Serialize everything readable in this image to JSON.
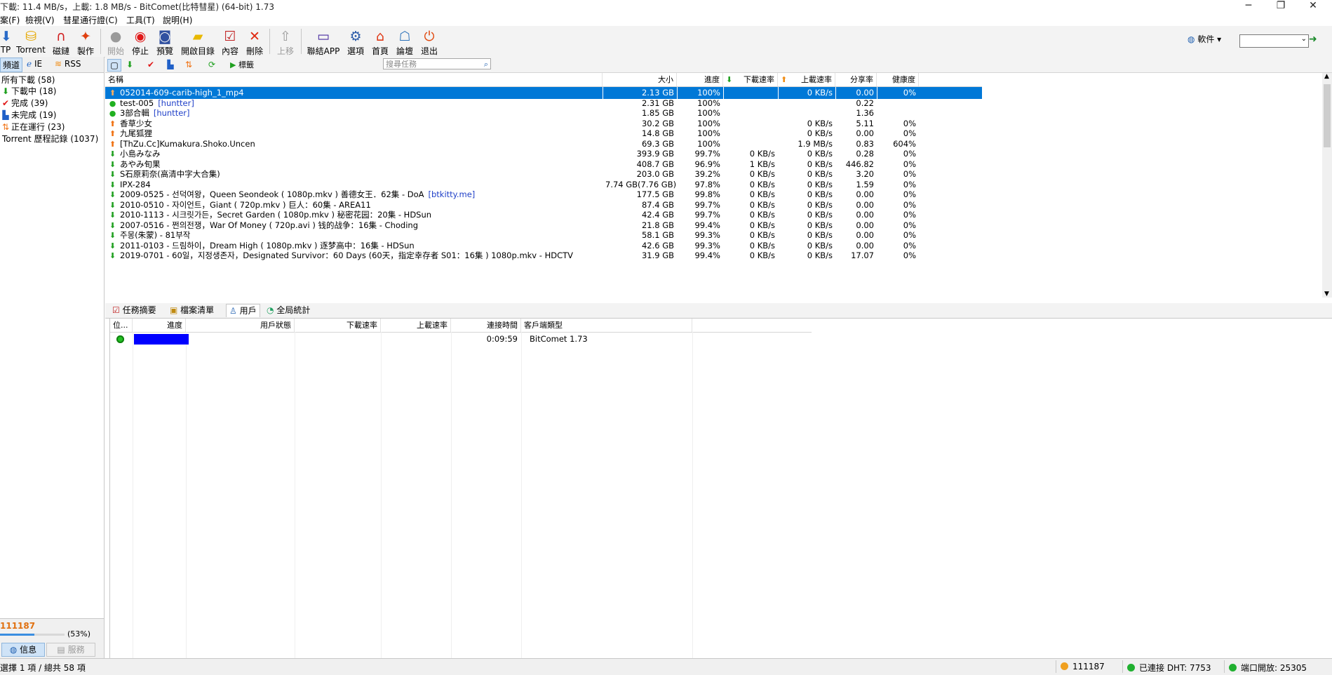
{
  "window": {
    "title": "下載: 11.4 MB/s，上載: 1.8 MB/s - BitComet(比特彗星) (64-bit) 1.73",
    "controls": [
      "─",
      "❐",
      "✕"
    ]
  },
  "menu": [
    "案(F)",
    "檢視(V)",
    "彗星通行證(C)",
    "工具(T)",
    "說明(H)"
  ],
  "toolbar": {
    "buttons": [
      {
        "label": "TP",
        "icon": "http-icon"
      },
      {
        "label": "Torrent",
        "icon": "torrent-icon"
      },
      {
        "label": "磁鏈",
        "icon": "magnet-icon"
      },
      {
        "label": "製作",
        "icon": "make-torrent-icon"
      },
      {
        "label": "開始",
        "icon": "start-icon",
        "disabled": true
      },
      {
        "label": "停止",
        "icon": "stop-icon"
      },
      {
        "label": "預覽",
        "icon": "preview-icon"
      },
      {
        "label": "開啟目錄",
        "icon": "folder-icon"
      },
      {
        "label": "內容",
        "icon": "properties-icon"
      },
      {
        "label": "刪除",
        "icon": "delete-icon"
      },
      {
        "label": "上移",
        "icon": "move-up-icon",
        "disabled": true
      },
      {
        "label": "聯結APP",
        "icon": "app-link-icon"
      },
      {
        "label": "選項",
        "icon": "options-icon"
      },
      {
        "label": "首頁",
        "icon": "home-icon"
      },
      {
        "label": "論壇",
        "icon": "forum-icon"
      },
      {
        "label": "退出",
        "icon": "exit-icon"
      }
    ],
    "software_label": "軟件 ▾",
    "search_value": ""
  },
  "sidebar": {
    "tabs": [
      "頻道",
      "IE",
      "RSS"
    ],
    "categories": [
      {
        "label": "所有下載 (58)",
        "icon": ""
      },
      {
        "label": "下載中 (18)",
        "icon": "download-arrow-icon"
      },
      {
        "label": "完成 (39)",
        "icon": "check-icon"
      },
      {
        "label": "未完成 (19)",
        "icon": "incomplete-icon"
      },
      {
        "label": "正在運行 (23)",
        "icon": "running-icon"
      },
      {
        "label": "Torrent 歷程記錄 (1037)",
        "icon": ""
      }
    ],
    "bottom": {
      "user_id": "111187",
      "progress_label": "(53%)",
      "progress": 0.53,
      "tab_info": "信息",
      "tab_service": "服務"
    }
  },
  "subtoolbar": {
    "filter_label": "標籤",
    "search_placeholder": "搜尋任務"
  },
  "tasks": {
    "columns": [
      "名稱",
      "大小",
      "進度",
      "下載速率",
      "上載速率",
      "分享率",
      "健康度"
    ],
    "rows": [
      {
        "name": "052014-609-carib-high_1_mp4",
        "tag": "",
        "size": "2.13 GB",
        "progress": "100%",
        "down": "",
        "up": "0 KB/s",
        "ratio": "0.00",
        "health": "0%",
        "status": "seeding",
        "selected": true
      },
      {
        "name": "test-005",
        "tag": "[huntter]",
        "size": "2.31 GB",
        "progress": "100%",
        "down": "",
        "up": "",
        "ratio": "0.22",
        "health": "",
        "status": "completed"
      },
      {
        "name": "3部合輯",
        "tag": "[huntter]",
        "size": "1.85 GB",
        "progress": "100%",
        "down": "",
        "up": "",
        "ratio": "1.36",
        "health": "",
        "status": "completed"
      },
      {
        "name": "香草少女",
        "tag": "",
        "size": "30.2 GB",
        "progress": "100%",
        "down": "",
        "up": "0 KB/s",
        "ratio": "5.11",
        "health": "0%",
        "status": "seeding"
      },
      {
        "name": "九尾狐狸",
        "tag": "",
        "size": "14.8 GB",
        "progress": "100%",
        "down": "",
        "up": "0 KB/s",
        "ratio": "0.00",
        "health": "0%",
        "status": "seeding"
      },
      {
        "name": "[ThZu.Cc]Kumakura.Shoko.Uncen",
        "tag": "",
        "size": "69.3 GB",
        "progress": "100%",
        "down": "",
        "up": "1.9 MB/s",
        "ratio": "0.83",
        "health": "604%",
        "status": "seeding"
      },
      {
        "name": "小島みなみ",
        "tag": "",
        "size": "393.9 GB",
        "progress": "99.7%",
        "down": "0 KB/s",
        "up": "0 KB/s",
        "ratio": "0.28",
        "health": "0%",
        "status": "downloading"
      },
      {
        "name": "あやみ旬果",
        "tag": "",
        "size": "408.7 GB",
        "progress": "96.9%",
        "down": "1 KB/s",
        "up": "0 KB/s",
        "ratio": "446.82",
        "health": "0%",
        "status": "downloading"
      },
      {
        "name": "S石原莉奈(高清中字大合集)",
        "tag": "",
        "size": "203.0 GB",
        "progress": "39.2%",
        "down": "0 KB/s",
        "up": "0 KB/s",
        "ratio": "3.20",
        "health": "0%",
        "status": "downloading"
      },
      {
        "name": "IPX-284",
        "tag": "",
        "size": "7.74 GB(7.76 GB)",
        "progress": "97.8%",
        "down": "0 KB/s",
        "up": "0 KB/s",
        "ratio": "1.59",
        "health": "0%",
        "status": "downloading"
      },
      {
        "name": "2009-0525 - 선덕여왕，Queen Seondeok ( 1080p.mkv ) 善德女王．62集 - DoA",
        "tag": "[btkitty.me]",
        "size": "177.5 GB",
        "progress": "99.8%",
        "down": "0 KB/s",
        "up": "0 KB/s",
        "ratio": "0.00",
        "health": "0%",
        "status": "downloading"
      },
      {
        "name": "2010-0510 - 자이언트，Giant ( 720p.mkv ) 巨人：60集 - AREA11",
        "tag": "",
        "size": "87.4 GB",
        "progress": "99.7%",
        "down": "0 KB/s",
        "up": "0 KB/s",
        "ratio": "0.00",
        "health": "0%",
        "status": "downloading"
      },
      {
        "name": "2010-1113 - 시크릿가든，Secret Garden ( 1080p.mkv ) 秘密花园：20集 - HDSun",
        "tag": "",
        "size": "42.4 GB",
        "progress": "99.7%",
        "down": "0 KB/s",
        "up": "0 KB/s",
        "ratio": "0.00",
        "health": "0%",
        "status": "downloading"
      },
      {
        "name": "2007-0516 - 쩐의전쟁，War Of Money ( 720p.avi ) 钱的战争：16集 - Choding",
        "tag": "",
        "size": "21.8 GB",
        "progress": "99.4%",
        "down": "0 KB/s",
        "up": "0 KB/s",
        "ratio": "0.00",
        "health": "0%",
        "status": "downloading"
      },
      {
        "name": "주몽(朱蒙) - 81부작",
        "tag": "",
        "size": "58.1 GB",
        "progress": "99.3%",
        "down": "0 KB/s",
        "up": "0 KB/s",
        "ratio": "0.00",
        "health": "0%",
        "status": "downloading"
      },
      {
        "name": "2011-0103 - 드림하이，Dream High ( 1080p.mkv ) 逐梦高中：16集 - HDSun",
        "tag": "",
        "size": "42.6 GB",
        "progress": "99.3%",
        "down": "0 KB/s",
        "up": "0 KB/s",
        "ratio": "0.00",
        "health": "0%",
        "status": "downloading"
      },
      {
        "name": "2019-0701 - 60일，지정생존자，Designated Survivor：60 Days (60天，指定幸存者 S01：16集 ) 1080p.mkv - HDCTV",
        "tag": "",
        "size": "31.9 GB",
        "progress": "99.4%",
        "down": "0 KB/s",
        "up": "0 KB/s",
        "ratio": "17.07",
        "health": "0%",
        "status": "downloading"
      }
    ]
  },
  "bottom_tabs": [
    "任務摘要",
    "檔案清單",
    "用戶",
    "全局統計"
  ],
  "peers": {
    "columns": [
      "位...",
      "進度",
      "用戶狀態",
      "下載速率",
      "上載速率",
      "連接時間",
      "客戶端類型"
    ],
    "rows": [
      {
        "connection_time": "0:09:59",
        "client": "BitComet 1.73",
        "progress": 1.0
      }
    ]
  },
  "statusbar": {
    "selection": "選擇 1 項 / 總共 58 項",
    "user_id": "111187",
    "dht": "已連接 DHT: 7753",
    "port": "端口開放: 25305"
  },
  "colors": {
    "selected_row": "#0078d7",
    "peer_progress": "#0000ff",
    "tag": "#2040c8"
  }
}
